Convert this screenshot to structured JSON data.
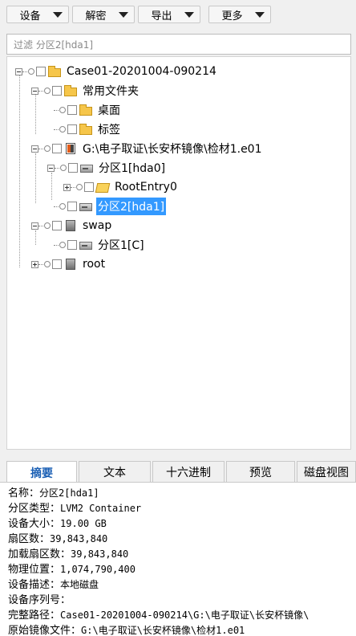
{
  "toolbar": {
    "buttons": [
      {
        "label": "设备"
      },
      {
        "label": "解密"
      },
      {
        "label": "导出"
      },
      {
        "label": "更多"
      }
    ]
  },
  "filter": {
    "placeholder": "过滤 分区2[hda1]"
  },
  "tree": {
    "root": "Case01-20201004-090214",
    "common_folder": "常用文件夹",
    "desktop": "桌面",
    "tags": "标签",
    "evidence": "G:\\电子取证\\长安杯镜像\\检材1.e01",
    "partition1": "分区1[hda0]",
    "root_entry": "RootEntry0",
    "partition2": "分区2[hda1]",
    "swap": "swap",
    "swap_partition": "分区1[C]",
    "root_node": "root"
  },
  "tabs": [
    {
      "label": "摘要",
      "active": true
    },
    {
      "label": "文本"
    },
    {
      "label": "十六进制"
    },
    {
      "label": "预览"
    },
    {
      "label": "磁盘视图"
    }
  ],
  "summary": {
    "name_key": "名称：",
    "name_val": "分区2[hda1]",
    "type_key": "分区类型：",
    "type_val": "LVM2 Container",
    "size_key": "设备大小：",
    "size_val": "19.00 GB",
    "sectors_key": "扇区数：",
    "sectors_val": "39,843,840",
    "loaded_key": "加载扇区数：",
    "loaded_val": "39,843,840",
    "position_key": "物理位置：",
    "position_val": "1,074,790,400",
    "desc_key": "设备描述：",
    "desc_val": "本地磁盘",
    "serial_key": "设备序列号：",
    "serial_val": "",
    "path_key": "完整路径：",
    "path_val": "Case01-20201004-090214\\G:\\电子取证\\长安杯镜像\\",
    "orig_key": "原始镜像文件：",
    "orig_val": "G:\\电子取证\\长安杯镜像\\检材1.e01"
  }
}
